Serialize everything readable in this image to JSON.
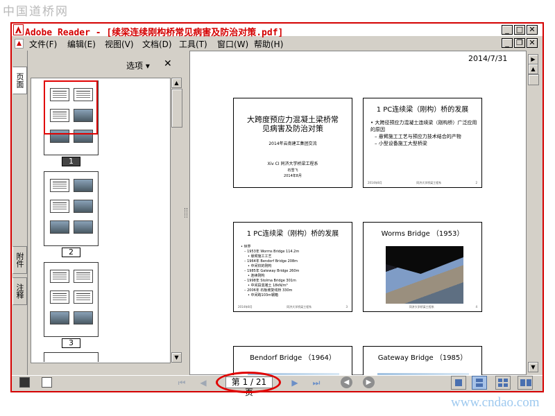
{
  "watermark": {
    "top": "中国道桥网",
    "bottom": "www.cndao.com"
  },
  "window": {
    "title": "Adobe Reader - [续梁连续刚构桥常见病害及防治对策.pdf]",
    "controls": {
      "minimize": "_",
      "maximize": "□",
      "close": "✕",
      "restore": "❐"
    }
  },
  "menu": {
    "items": [
      "文件(F)",
      "编辑(E)",
      "视图(V)",
      "文档(D)",
      "工具(T)",
      "窗口(W)",
      "帮助(H)"
    ]
  },
  "side_tabs": [
    "页面",
    "附件",
    "注释"
  ],
  "thumbnail_panel": {
    "options_label": "选项 ▾",
    "close": "✕",
    "pages": [
      {
        "label": "1",
        "active": true
      },
      {
        "label": "2",
        "active": false
      },
      {
        "label": "3",
        "active": false
      }
    ]
  },
  "document": {
    "date": "2014/7/31",
    "slides": [
      {
        "title": "大跨度预应力混凝土梁桥常见病害及防治对策",
        "subtitle": "2014年云南建工集团交流",
        "author": "石雪飞",
        "date": "2014年8月",
        "logo": "Xiv CI 同济大学桥梁工程系"
      },
      {
        "title": "1 PC连续梁（刚构）桥的发展",
        "bullets": [
          "• 大跨径预应力混凝土连续梁（刚构桥）广泛应用的原因",
          "– 悬臂施工工艺与预应力技术结合的产物",
          "– 小型设备施工大型桥梁"
        ],
        "footer_left": "2014年8月",
        "footer_mid": "同济大学桥梁工程系",
        "footer_right": "2"
      },
      {
        "title": "1 PC连续梁（刚构）桥的发展",
        "bullets": [
          "• 世界",
          "– 1953年 Worms Bridge 114.2m",
          "• 悬臂施工工艺",
          "– 1964年 Bendorf Bridge 208m",
          "• 中间铰的刚构",
          "– 1985年 Gateway Bridge 260m",
          "• 连续刚构",
          "– 1998年 Stolma Bridge 301m",
          "• 中间段混凝土 18kN/m³",
          "– 2006年 石板坡复线桥 330m",
          "• 中间跨103m钢箱"
        ],
        "footer_left": "2014年8月",
        "footer_mid": "同济大学桥梁工程系",
        "footer_right": "3"
      },
      {
        "title": "Worms Bridge （1953）",
        "footer_mid": "同济大学桥梁工程系",
        "footer_right": "4"
      },
      {
        "title": "Bendorf Bridge （1964）"
      },
      {
        "title": "Gateway Bridge （1985）"
      }
    ]
  },
  "navigation": {
    "first": "⏮",
    "prev": "◀",
    "page_display": "第 1 / 21 页",
    "next": "▶",
    "last": "⏭",
    "back": "◀",
    "forward": "▶"
  },
  "colors": {
    "title_red": "#d40000",
    "highlight_red": "#e00000",
    "chrome_gray": "#d4d0c8",
    "nav_blue": "#6b8fc7"
  }
}
